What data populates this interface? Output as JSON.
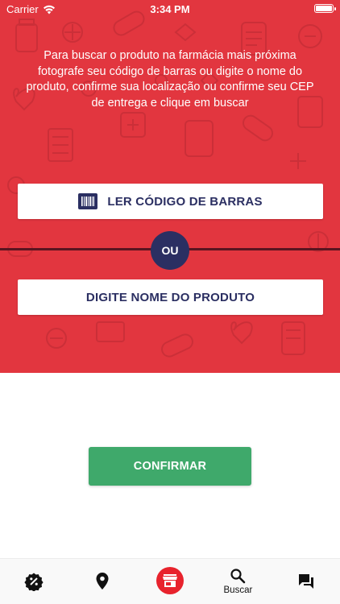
{
  "status_bar": {
    "carrier": "Carrier",
    "time": "3:34 PM"
  },
  "colors": {
    "brand_red": "#e2363f",
    "navy": "#2b2f62",
    "confirm_green": "#3fa96b"
  },
  "hero": {
    "instructions": "Para buscar o produto na farmácia mais próxima fotografe seu código de barras ou digite o nome do produto, confirme sua localização ou confirme seu CEP de entrega e clique em buscar",
    "barcode_button": {
      "label": "LER CÓDIGO DE BARRAS",
      "icon": "barcode-icon"
    },
    "divider_label": "OU",
    "name_button": {
      "label": "DIGITE NOME DO PRODUTO"
    }
  },
  "confirm_button": {
    "label": "CONFIRMAR"
  },
  "tabbar": {
    "tabs": [
      {
        "icon": "discount-badge-icon",
        "label": ""
      },
      {
        "icon": "location-pin-icon",
        "label": ""
      },
      {
        "icon": "store-icon",
        "label": ""
      },
      {
        "icon": "search-icon",
        "label": "Buscar"
      },
      {
        "icon": "chat-icon",
        "label": ""
      }
    ]
  }
}
